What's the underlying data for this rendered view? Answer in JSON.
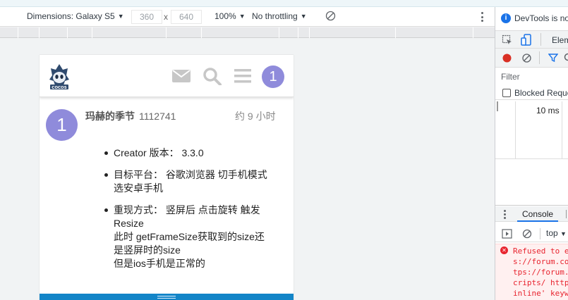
{
  "device_toolbar": {
    "dimensions_label": "Dimensions: Galaxy S5",
    "width_value": "360",
    "separator": "x",
    "height_value": "640",
    "zoom_label": "100%",
    "throttling_label": "No throttling"
  },
  "site": {
    "header_avatar_letter": "1",
    "logo_alt": "COCOS",
    "header_icons": [
      "mail-icon",
      "search-icon",
      "menu-icon"
    ]
  },
  "post": {
    "avatar_letter": "1",
    "username": "玛赫的季节",
    "user_id": "1112741",
    "time": "约 9 小时",
    "items": [
      {
        "lines": [
          "Creator 版本： 3.3.0"
        ]
      },
      {
        "lines": [
          "目标平台： 谷歌浏览器 切手机模式",
          "选安卓手机"
        ]
      },
      {
        "lines": [
          "重现方式： 竖屏后 点击旋转 触发",
          "Resize",
          "此时 getFrameSize获取到的size还",
          "是竖屏时的size",
          "但是ios手机是正常的"
        ]
      }
    ]
  },
  "devtools": {
    "info_text": "DevTools is no",
    "tab_elements": "Elem",
    "filter_placeholder": "Filter",
    "blocked_requests": "Blocked Reque",
    "timing_label": "10 ms",
    "console_tab": "Console",
    "context_select": "top",
    "error_lines": [
      "Refused to e",
      "s://forum.co",
      "tps://forum.",
      "cripts/ http",
      "inline' keyw"
    ]
  },
  "colors": {
    "avatar": "#8f8bdb",
    "bottom_bar": "#1385c8",
    "error_text": "#e8242f",
    "accent": "#1a73e8"
  }
}
